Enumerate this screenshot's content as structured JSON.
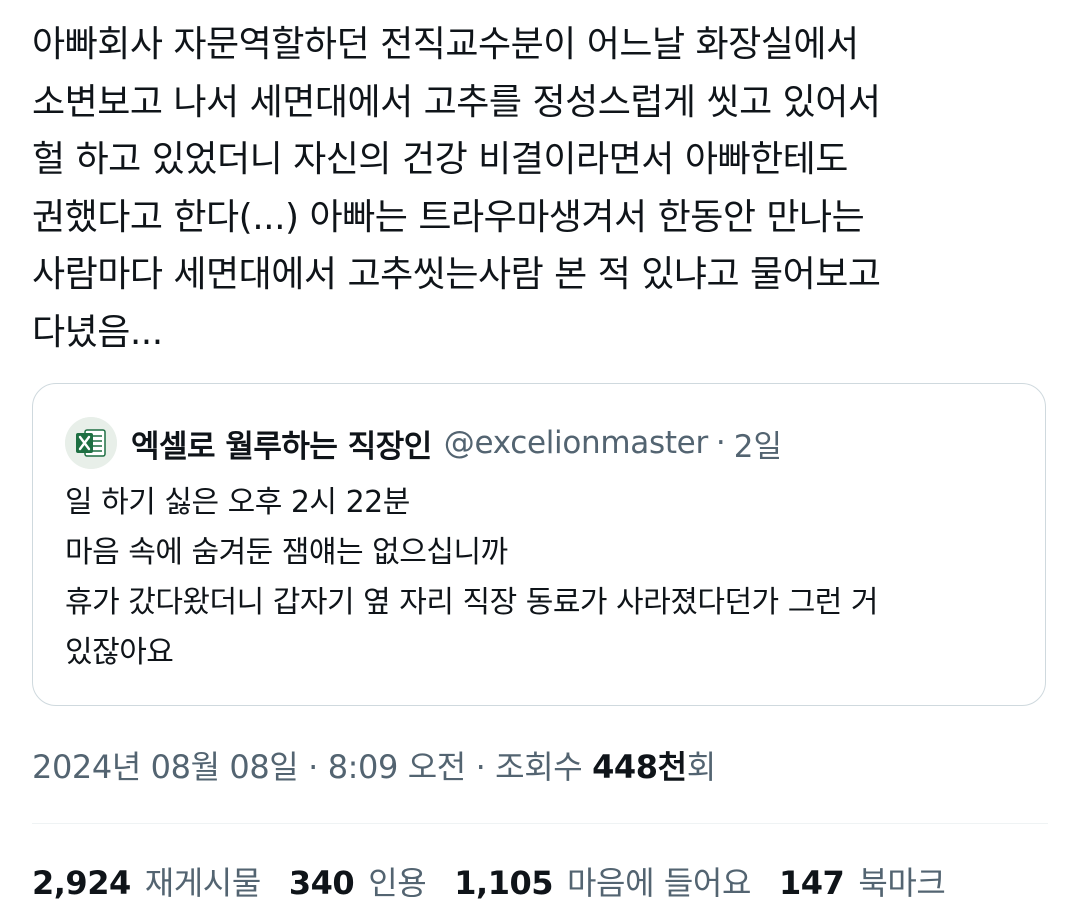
{
  "tweet": {
    "lines": [
      "아빠회사 자문역할하던 전직교수분이 어느날 화장실에서",
      "소변보고 나서 세면대에서 고추를 정성스럽게 씻고 있어서",
      "헐 하고 있었더니 자신의 건강 비결이라면서 아빠한테도",
      "권했다고 한다(...) 아빠는 트라우마생겨서 한동안 만나는",
      "사람마다 세면대에서 고추씻는사람 본 적 있냐고 물어보고",
      "다녔음..."
    ]
  },
  "quote": {
    "avatar_icon": "excel-icon",
    "name": "엑셀로 월루하는 직장인",
    "handle": "@excelionmaster",
    "separator": "·",
    "time": "2일",
    "lines": [
      "일 하기 싫은 오후 2시 22분",
      "마음 속에 숨겨둔 잼얘는 없으십니까",
      "휴가 갔다왔더니 갑자기 옆 자리 직장 동료가 사라졌다던가 그런 거",
      "있잖아요"
    ]
  },
  "meta": {
    "date": "2024년 08월 08일",
    "sep1": "·",
    "time": "8:09 오전",
    "sep2": "·",
    "views_label": "조회수",
    "views_count": "448천",
    "views_suffix": "회"
  },
  "stats": {
    "retweets": {
      "count": "2,924",
      "label": "재게시물"
    },
    "quotes": {
      "count": "340",
      "label": "인용"
    },
    "likes": {
      "count": "1,105",
      "label": "마음에 들어요"
    },
    "bookmarks": {
      "count": "147",
      "label": "북마크"
    }
  },
  "colors": {
    "text": "#0f1419",
    "secondary": "#536471",
    "border": "#cfd9de",
    "excel_green": "#1d6f42"
  }
}
